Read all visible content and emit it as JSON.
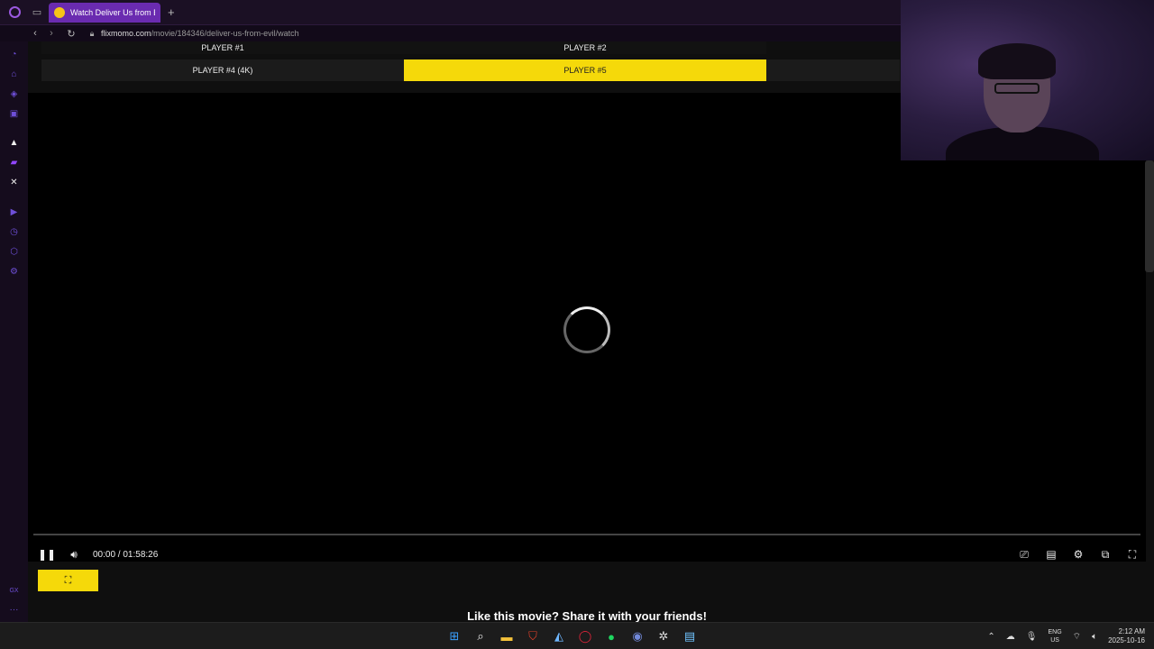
{
  "browser": {
    "tab_title": "Watch Deliver Us from Evil",
    "new_tab": "+",
    "url_host": "flixmomo.com",
    "url_path": "/movie/184346/deliver-us-from-evil/watch"
  },
  "players": {
    "row1": [
      "PLAYER #1",
      "PLAYER #2"
    ],
    "row2": [
      "PLAYER #4 (4K)",
      "PLAYER #5"
    ],
    "active": "PLAYER #5"
  },
  "video": {
    "state": "loading",
    "time": "00:00 / 01:58:26",
    "progress": 0
  },
  "share_text": "Like this movie? Share it with your friends!",
  "sidebar_bottom": {
    "gx_label": "GX",
    "more": "···"
  },
  "system": {
    "lang_top": "ENG",
    "lang_bottom": "US",
    "time": "2:12 AM",
    "date": "2025-10-16"
  },
  "colors": {
    "accent": "#f5d90a",
    "tab": "#6a2bb0",
    "brand": "#9b59e0"
  }
}
